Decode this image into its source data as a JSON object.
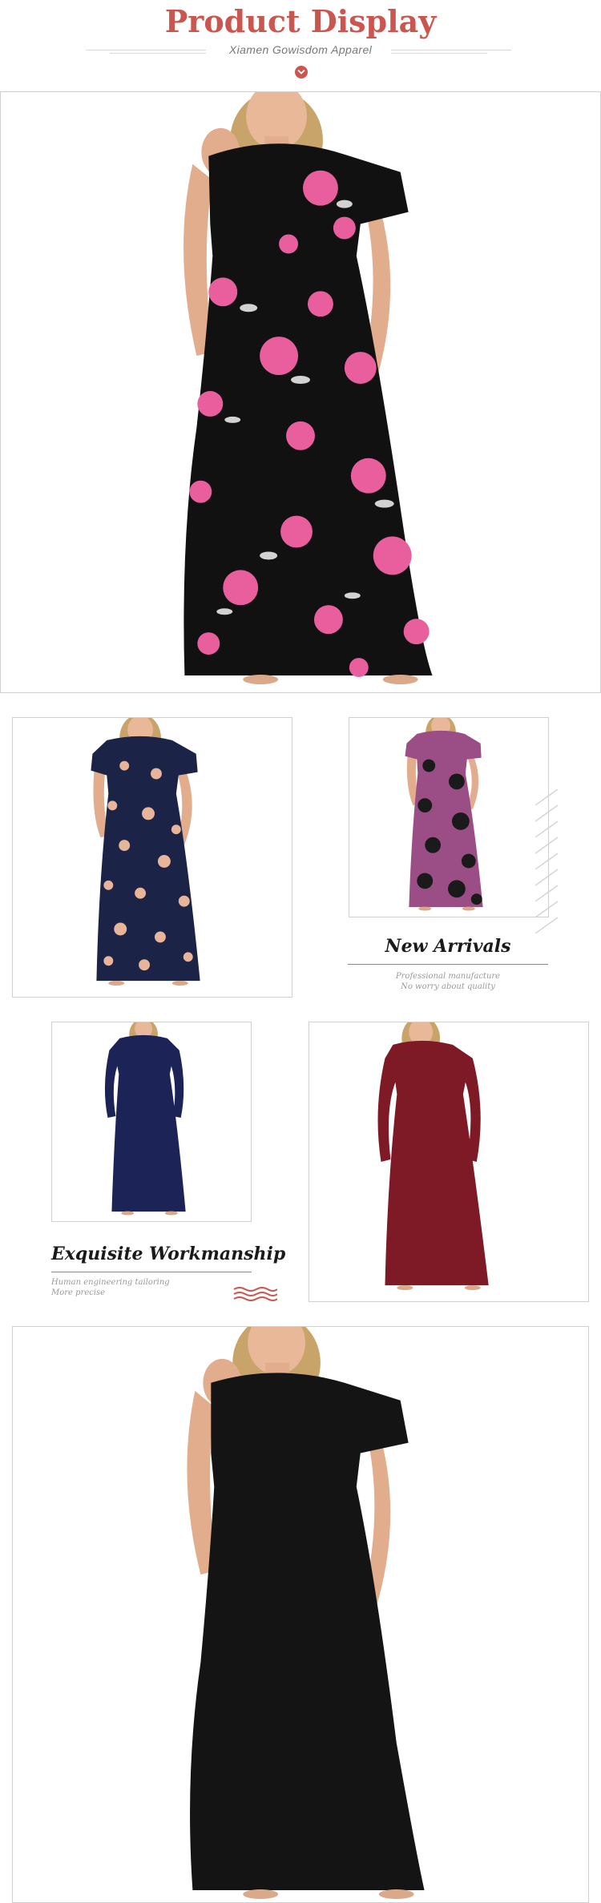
{
  "header": {
    "title": "Product Display",
    "subtitle": "Xiamen Gowisdom Apparel",
    "down_icon": "chevron-down-icon",
    "accent_color": "#c9574f"
  },
  "products": [
    {
      "name": "black floral short-sleeve maxi dress",
      "color": "#111111",
      "print": "pink rose"
    },
    {
      "name": "navy floral short-sleeve maxi dress",
      "color": "#1b2347",
      "print": "peach floral"
    },
    {
      "name": "purple floral short-sleeve maxi dress",
      "color": "#9b4d86",
      "print": "black floral"
    },
    {
      "name": "navy long-sleeve maxi dress",
      "color": "#1c2457"
    },
    {
      "name": "wine red long-sleeve maxi dress",
      "color": "#7d1a26"
    },
    {
      "name": "black short-sleeve maxi dress",
      "color": "#141414"
    }
  ],
  "new_arrivals": {
    "title": "New Arrivals",
    "line1": "Professional manufacture",
    "line2": "No worry about quality"
  },
  "workmanship": {
    "title": "Exquisite Workmanship",
    "line1": "Human engineering tailoring",
    "line2": "More precise"
  }
}
